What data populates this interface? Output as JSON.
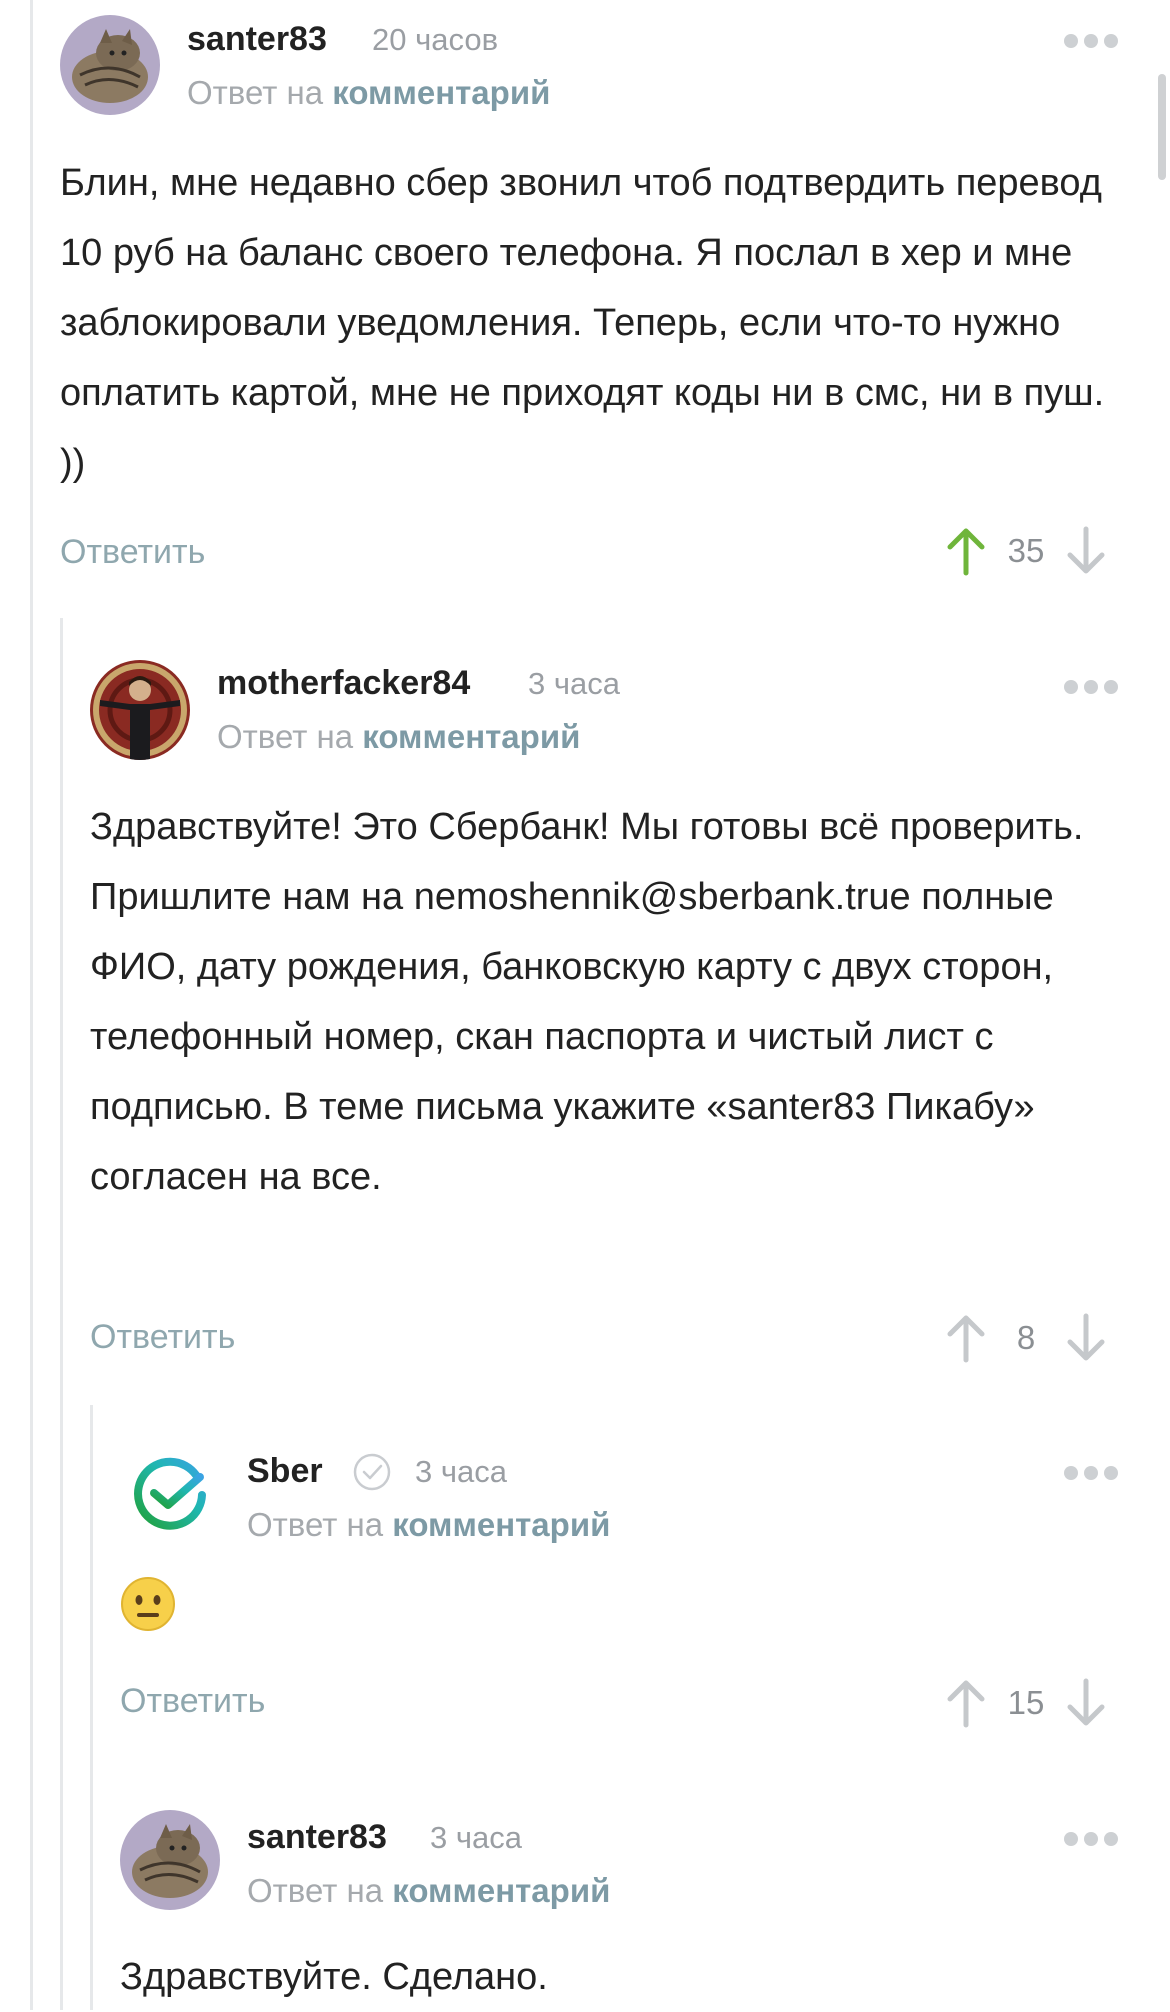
{
  "comments": [
    {
      "username": "santer83",
      "time": "20 часов",
      "reply_prefix": "Ответ на",
      "reply_link": "комментарий",
      "text": "Блин, мне недавно сбер звонил чтоб подтвердить перевод 10 руб на баланс своего телефона. Я послал в хер и мне заблокировали уведомления. Теперь, если что-то нужно оплатить картой, мне не приходят коды ни в смс, ни в пуш. ))",
      "reply_label": "Ответить",
      "rating": "35",
      "upvoted": true
    },
    {
      "username": "motherfacker84",
      "time": "3 часа",
      "reply_prefix": "Ответ на",
      "reply_link": "комментарий",
      "text": "Здравствуйте! Это Сбербанк! Мы готовы всё проверить. Пришлите нам на nemoshennik@sberbank.true полные ФИО, дату рождения, банковскую карту с двух сторон, телефонный номер, скан паспорта и чистый лист с подписью. В теме письма укажите «santer83 Пикабу» согласен на все.",
      "reply_label": "Ответить",
      "rating": "8",
      "upvoted": false
    },
    {
      "username": "Sber",
      "time": "3 часа",
      "reply_prefix": "Ответ на",
      "reply_link": "комментарий",
      "text": "😐",
      "reply_label": "Ответить",
      "rating": "15",
      "upvoted": false,
      "verified": true
    },
    {
      "username": "santer83",
      "time": "3 часа",
      "reply_prefix": "Ответ на",
      "reply_link": "комментарий",
      "text": "Здравствуйте. Сделано."
    }
  ],
  "icons": {
    "upvote": "arrow-up-icon",
    "downvote": "arrow-down-icon",
    "more": "more-dots-icon",
    "verified": "verified-check-icon"
  },
  "colors": {
    "upvote_active": "#6fb53b",
    "arrow_inactive": "#c5c8cb",
    "link": "#7d9aa5",
    "sber_green": "#21a038"
  }
}
